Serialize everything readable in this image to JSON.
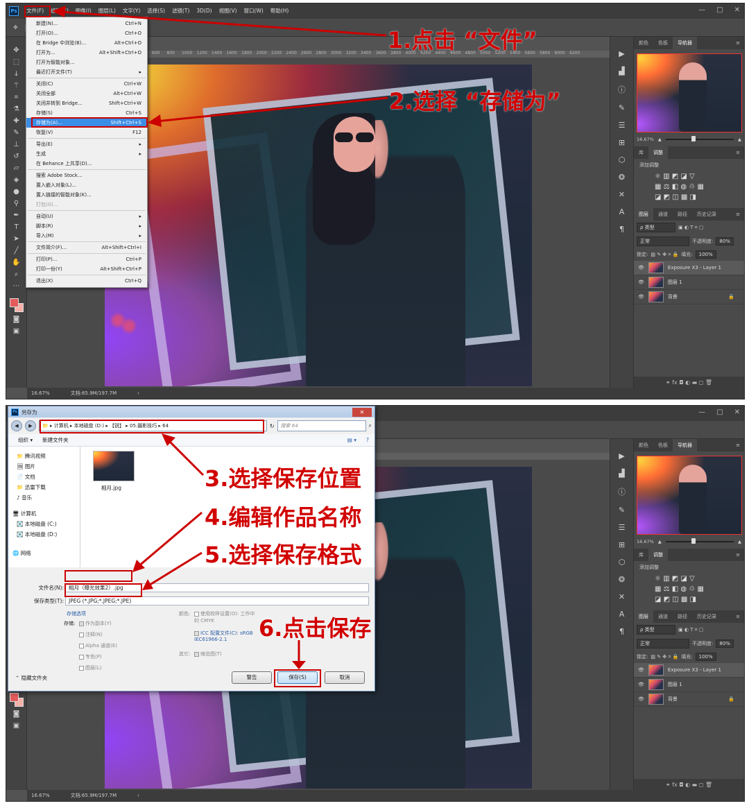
{
  "app": {
    "logo": "Ps",
    "menu": [
      "文件(F)",
      "编辑(E)",
      "图像(I)",
      "图层(L)",
      "文字(Y)",
      "选择(S)",
      "滤镜(T)",
      "3D(D)",
      "视图(V)",
      "窗口(W)",
      "帮助(H)"
    ],
    "window_controls": [
      "—",
      "□",
      "✕"
    ]
  },
  "ruler_ticks": [
    "600",
    "800",
    "1000",
    "1200",
    "1400",
    "1600",
    "1800",
    "2000",
    "2200",
    "2400",
    "2600",
    "2800",
    "3000",
    "3200",
    "3400",
    "3600",
    "3800",
    "4000",
    "4200",
    "4400",
    "4600",
    "4800",
    "5000",
    "5200",
    "5400",
    "5600",
    "5800",
    "6000",
    "6200"
  ],
  "ruler_ticks_2": [
    "3600",
    "3800",
    "4000",
    "4200",
    "4400",
    "4600",
    "4800",
    "5000",
    "5200",
    "5400",
    "5600",
    "5800",
    "6000",
    "6200"
  ],
  "status": {
    "zoom": "16.67%",
    "doc": "文档:65.9M/197.7M",
    "arrow": "›"
  },
  "file_menu": [
    {
      "label": "新建(N)...",
      "shortcut": "Ctrl+N"
    },
    {
      "label": "打开(O)...",
      "shortcut": "Ctrl+O"
    },
    {
      "label": "在 Bridge 中浏览(B)...",
      "shortcut": "Alt+Ctrl+O"
    },
    {
      "label": "打开为...",
      "shortcut": "Alt+Shift+Ctrl+O"
    },
    {
      "label": "打开为智能对象...",
      "shortcut": ""
    },
    {
      "label": "最近打开文件(T)",
      "shortcut": "▸"
    },
    {
      "sep": true
    },
    {
      "label": "关闭(C)",
      "shortcut": "Ctrl+W"
    },
    {
      "label": "关闭全部",
      "shortcut": "Alt+Ctrl+W"
    },
    {
      "label": "关闭并转到 Bridge...",
      "shortcut": "Shift+Ctrl+W"
    },
    {
      "label": "存储(S)",
      "shortcut": "Ctrl+S"
    },
    {
      "label": "存储为(A)...",
      "shortcut": "Shift+Ctrl+S",
      "highlight": true
    },
    {
      "label": "恢复(V)",
      "shortcut": "F12"
    },
    {
      "sep": true
    },
    {
      "label": "导出(E)",
      "shortcut": "▸"
    },
    {
      "label": "生成",
      "shortcut": "▸"
    },
    {
      "label": "在 Behance 上共享(D)...",
      "shortcut": ""
    },
    {
      "sep": true
    },
    {
      "label": "搜索 Adobe Stock...",
      "shortcut": ""
    },
    {
      "label": "置入嵌入对象(L)...",
      "shortcut": ""
    },
    {
      "label": "置入链接的智能对象(K)...",
      "shortcut": ""
    },
    {
      "label": "打包(G)...",
      "shortcut": "",
      "disabled": true
    },
    {
      "sep": true
    },
    {
      "label": "自动(U)",
      "shortcut": "▸"
    },
    {
      "label": "脚本(R)",
      "shortcut": "▸"
    },
    {
      "label": "导入(M)",
      "shortcut": "▸"
    },
    {
      "sep": true
    },
    {
      "label": "文件简介(F)...",
      "shortcut": "Alt+Shift+Ctrl+I"
    },
    {
      "sep": true
    },
    {
      "label": "打印(P)...",
      "shortcut": "Ctrl+P"
    },
    {
      "label": "打印一份(Y)",
      "shortcut": "Alt+Shift+Ctrl+P"
    },
    {
      "sep": true
    },
    {
      "label": "退出(X)",
      "shortcut": "Ctrl+Q"
    }
  ],
  "right_panel": {
    "tabs_top": [
      "颜色",
      "色板",
      "导航器"
    ],
    "zoom": "16.67%",
    "tabs_mid": [
      "库",
      "调整"
    ],
    "adj_title": "添加调整",
    "adj_rows": [
      "☼ ▥ ◩ ◪ ▽",
      "▦ ⚖ ◧ ◍ ♲ ▦",
      "◪ ◩ ◫ ▩ ◨"
    ],
    "tabs_layers": [
      "图层",
      "通道",
      "路径",
      "历史记录"
    ],
    "kind": "ρ 类型",
    "blend": "正常",
    "opacity_label": "不透明度:",
    "opacity": "80%",
    "lock_label": "锁定:",
    "fill_label": "填充:",
    "fill": "100%",
    "layers": [
      {
        "name": "Exposure X3 - Layer 1",
        "active": true
      },
      {
        "name": "图层 1",
        "active": false
      },
      {
        "name": "背景",
        "active": false,
        "locked": true
      }
    ],
    "bottom_icons": "⚭  fx  ◘  ◐  ▬  ◻  🗑"
  },
  "annotations": {
    "step1": "1.点击 “文件”",
    "step2": "2.选择 “存储为”",
    "step3": "3.选择保存位置",
    "step4": "4.编辑作品名称",
    "step5": "5.选择保存格式",
    "step6": "6.点击保存"
  },
  "save_dialog": {
    "title": "另存为",
    "path": "▸ 计算机 ▸ 本地磁盘 (D:) ▸ 【锐】 ▸ 05.摄影技巧 ▸ 64",
    "search_placeholder": "搜索 64",
    "organize": "组织 ▾",
    "new_folder": "新建文件夹",
    "tree": [
      "腾讯视频",
      "图片",
      "文档",
      "迅雷下载",
      "音乐"
    ],
    "computer": "计算机",
    "drives": [
      "本地磁盘 (C:)",
      "本地磁盘 (D:)"
    ],
    "network": "网络",
    "file": "相月.jpg",
    "filename_label": "文件名(N):",
    "filename": "相月（曝光效果2）.jpg",
    "type_label": "保存类型(T):",
    "type": "JPEG (*.JPG;*.JPEG;*.JPE)",
    "save_options": "存储选项",
    "store_label": "存储:",
    "opt_copy": "作为副本(Y)",
    "opt_notes": "注释(N)",
    "opt_alpha": "Alpha 通道(E)",
    "opt_spot": "专色(P)",
    "opt_layers": "图层(L)",
    "color_label": "颜色:",
    "proof": "使用校样设置(O): 工作中的 CMYK",
    "icc": "ICC 配置文件(C): sRGB IEC61966-2.1",
    "other_label": "其它:",
    "thumb": "缩览图(T)",
    "hide_folders": "隐藏文件夹",
    "warning_btn": "警告",
    "save_btn": "保存(S)",
    "cancel_btn": "取消"
  }
}
